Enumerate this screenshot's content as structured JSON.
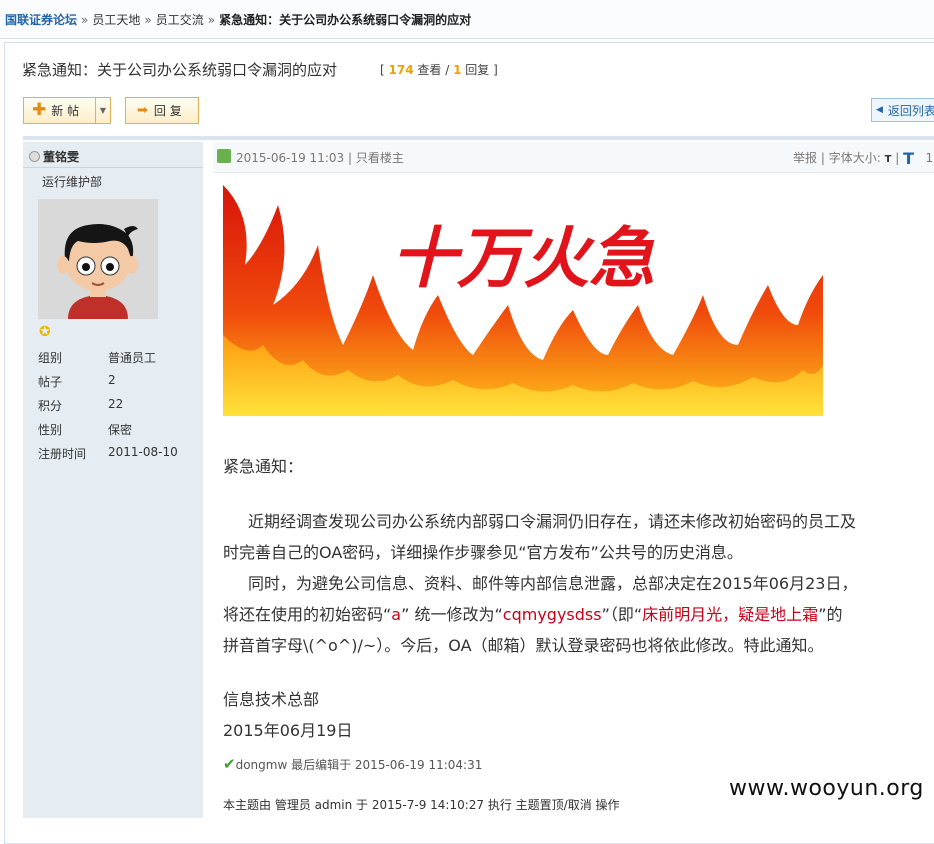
{
  "breadcrumb": {
    "items": [
      "国联证券论坛",
      "员工天地",
      "员工交流"
    ],
    "separator": "»",
    "current": "紧急通知：关于公司办公系统弱口令漏洞的应对"
  },
  "thread": {
    "title": "紧急通知：关于公司办公系统弱口令漏洞的应对",
    "views": "174",
    "views_label": "查看",
    "replies": "1",
    "replies_label": "回复"
  },
  "toolbar": {
    "new_label": "新 帖",
    "reply_label": "回 复",
    "back_label": "返回列表"
  },
  "author": {
    "name": "董铭雯",
    "dept": "运行维护部",
    "fields": [
      {
        "k": "组别",
        "v": "普通员工"
      },
      {
        "k": "帖子",
        "v": "2"
      },
      {
        "k": "积分",
        "v": "22"
      },
      {
        "k": "性别",
        "v": "保密"
      },
      {
        "k": "注册时间",
        "v": "2011-08-10"
      }
    ]
  },
  "post": {
    "datetime": "2015-06-19 11:03",
    "only_author": "只看楼主",
    "report": "举报",
    "font_size_label": "字体大小:",
    "font_small": "T",
    "font_large": "T",
    "floor": "1",
    "banner_text": "十万火急",
    "greeting": "紧急通知：",
    "p1_l1": "近期经调查发现公司办公系统内部弱口令漏洞仍旧存在，请还未修改初始密码的员工及",
    "p1_l2": "时完善自己的OA密码，详细操作步骤参见“官方发布”公共号的历史消息。",
    "p2_l1": "同时，为避免公司信息、资料、邮件等内部信息泄露，总部决定在2015年06月23日，",
    "p2_l2_a": "将还在使用的初始密码“",
    "p2_l2_b": "a",
    "p2_l2_c": "” 统一修改为“",
    "p2_l2_d": "cqmygysdss",
    "p2_l2_e": "”（即“",
    "p2_l2_f": "床前明月光，疑是地上霜",
    "p2_l2_g": "”的",
    "p2_l3": "拼音首字母\\(^o^)/~）。今后，OA（邮箱）默认登录密码也将依此修改。特此通知。",
    "sign_dept": "信息技术总部",
    "sign_date": "2015年06月19日",
    "edit_user": "dongmw",
    "edit_text": "最后编辑于 2015-06-19 11:04:31",
    "mod_text": "本主题由 管理员 admin 于 2015-7-9 14:10:27 执行 主题置顶/取消 操作"
  },
  "watermark": "www.wooyun.org",
  "colors": {
    "link": "#2366a8",
    "highlight": "#c8001a",
    "count": "#f0a000"
  }
}
